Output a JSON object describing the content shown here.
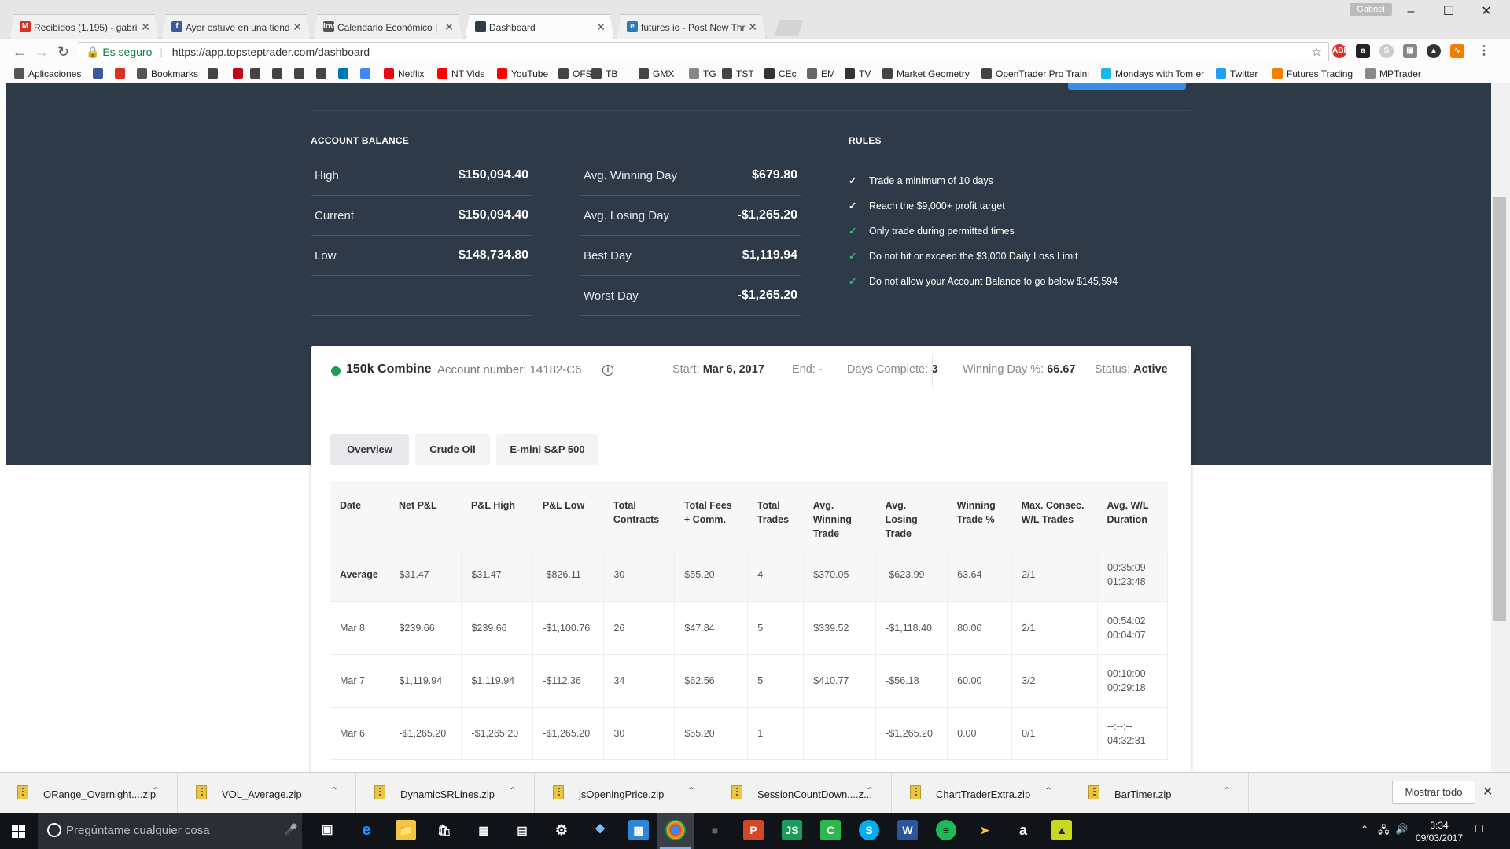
{
  "browser": {
    "tabs": [
      {
        "title": "Recibidos (1.195) - gabri",
        "icon": "gmail-icon",
        "color": "#d93025",
        "glyph": "M"
      },
      {
        "title": "Ayer estuve en una tiend",
        "icon": "facebook-icon",
        "color": "#3b5998",
        "glyph": "f"
      },
      {
        "title": "Calendario Económico | ",
        "icon": "investing-icon",
        "color": "#555555",
        "glyph": "Inv"
      },
      {
        "title": "Dashboard",
        "icon": "topstep-icon",
        "color": "#2e3a47",
        "glyph": "",
        "active": true
      },
      {
        "title": "futures io - Post New Thr",
        "icon": "futuresio-icon",
        "color": "#2a7ab8",
        "glyph": "e"
      }
    ],
    "profile": "Gabriel",
    "secure_label": "Es seguro",
    "url": "https://app.topsteptrader.com/dashboard",
    "bookmarks": [
      {
        "label": "Aplicaciones",
        "icon": "apps-grid-icon"
      },
      {
        "label": "",
        "icon": "facebook-icon"
      },
      {
        "label": "",
        "icon": "gmail-icon"
      },
      {
        "label": "Bookmarks",
        "icon": "star-icon"
      },
      {
        "label": "",
        "icon": "bookmark-icon"
      },
      {
        "label": "",
        "icon": "pinterest-icon"
      },
      {
        "label": "",
        "icon": "bookmark-icon"
      },
      {
        "label": "",
        "icon": "bookmark-icon"
      },
      {
        "label": "",
        "icon": "bookmark-icon"
      },
      {
        "label": "",
        "icon": "bookmark-icon"
      },
      {
        "label": "",
        "icon": "linkedin-icon"
      },
      {
        "label": "",
        "icon": "google-icon"
      },
      {
        "label": "Netflix",
        "icon": "netflix-icon"
      },
      {
        "label": "NT Vids",
        "icon": "youtube-icon"
      },
      {
        "label": "YouTube",
        "icon": "youtube-icon"
      },
      {
        "label": "OFS",
        "icon": "bookmark-icon"
      },
      {
        "label": "TB",
        "icon": "bookmark-icon"
      },
      {
        "label": "GMX",
        "icon": "bookmark-icon"
      },
      {
        "label": "TG",
        "icon": "page-icon"
      },
      {
        "label": "TST",
        "icon": "bookmark-icon"
      },
      {
        "label": "CEc",
        "icon": "investing-icon"
      },
      {
        "label": "EM",
        "icon": "globe-icon"
      },
      {
        "label": "TV",
        "icon": "search-icon"
      },
      {
        "label": "Market Geometry",
        "icon": "bookmark-icon"
      },
      {
        "label": "OpenTrader Pro Traini",
        "icon": "bookmark-icon"
      },
      {
        "label": "Mondays with Tom er",
        "icon": "vimeo-icon"
      },
      {
        "label": "Twitter",
        "icon": "twitter-icon"
      },
      {
        "label": "Futures Trading",
        "icon": "blogger-icon"
      },
      {
        "label": "MPTrader",
        "icon": "page-icon"
      }
    ]
  },
  "dashboard": {
    "account_balance_title": "ACCOUNT BALANCE",
    "rules_title": "RULES",
    "balance_rows": [
      {
        "label": "High",
        "value": "$150,094.40"
      },
      {
        "label": "Current",
        "value": "$150,094.40"
      },
      {
        "label": "Low",
        "value": "$148,734.80"
      },
      {
        "label": "",
        "value": ""
      }
    ],
    "day_rows": [
      {
        "label": "Avg. Winning Day",
        "value": "$679.80"
      },
      {
        "label": "Avg. Losing Day",
        "value": "-$1,265.20"
      },
      {
        "label": "Best Day",
        "value": "$1,119.94"
      },
      {
        "label": "Worst Day",
        "value": "-$1,265.20"
      }
    ],
    "rules": [
      {
        "text": "Trade a minimum of 10 days",
        "status": "white"
      },
      {
        "text": "Reach the $9,000+ profit target",
        "status": "white"
      },
      {
        "text": "Only trade during permitted times",
        "status": "green"
      },
      {
        "text": "Do not hit or exceed the $3,000 Daily Loss Limit",
        "status": "green"
      },
      {
        "text": "Do not allow your Account Balance to go below $145,594",
        "status": "green"
      }
    ],
    "combine": {
      "name": "150k Combine",
      "account_label": "Account number: 14182-C6",
      "start_label": "Start:",
      "start_value": "Mar 6, 2017",
      "end_label": "End:",
      "end_value": "-",
      "days_label": "Days Complete:",
      "days_value": "3",
      "winning_label": "Winning Day %:",
      "winning_value": "66.67",
      "status_label": "Status:",
      "status_value": "Active",
      "status_color": "#1f9d55"
    },
    "tabs": [
      "Overview",
      "Crude Oil",
      "E-mini S&P 500"
    ],
    "table": {
      "headers": [
        "Date",
        "Net P&L",
        "P&L High",
        "P&L Low",
        "Total\nContracts",
        "Total Fees\n+ Comm.",
        "Total\nTrades",
        "Avg.\nWinning\nTrade",
        "Avg.\nLosing\nTrade",
        "Winning\nTrade %",
        "Max. Consec.\nW/L Trades",
        "Avg. W/L\nDuration"
      ],
      "rows": [
        [
          "Average",
          "$31.47",
          "$31.47",
          "-$826.11",
          "30",
          "$55.20",
          "4",
          "$370.05",
          "-$623.99",
          "63.64",
          "2/1",
          "00:35:09\n01:23:48"
        ],
        [
          "Mar 8",
          "$239.66",
          "$239.66",
          "-$1,100.76",
          "26",
          "$47.84",
          "5",
          "$339.52",
          "-$1,118.40",
          "80.00",
          "2/1",
          "00:54:02\n00:04:07"
        ],
        [
          "Mar 7",
          "$1,119.94",
          "$1,119.94",
          "-$112.36",
          "34",
          "$62.56",
          "5",
          "$410.77",
          "-$56.18",
          "60.00",
          "3/2",
          "00:10:00\n00:29:18"
        ],
        [
          "Mar 6",
          "-$1,265.20",
          "-$1,265.20",
          "-$1,265.20",
          "30",
          "$55.20",
          "1",
          "",
          "-$1,265.20",
          "0.00",
          "0/1",
          "--:--:--\n04:32:31"
        ]
      ]
    }
  },
  "downloads": {
    "items": [
      "ORange_Overnight....zip",
      "VOL_Average.zip",
      "DynamicSRLines.zip",
      "jsOpeningPrice.zip",
      "SessionCountDown....z...",
      "ChartTraderExtra.zip",
      "BarTimer.zip"
    ],
    "show_all": "Mostrar todo"
  },
  "taskbar": {
    "search_placeholder": "Pregúntame cualquier cosa",
    "time": "3:34",
    "date": "09/03/2017"
  }
}
